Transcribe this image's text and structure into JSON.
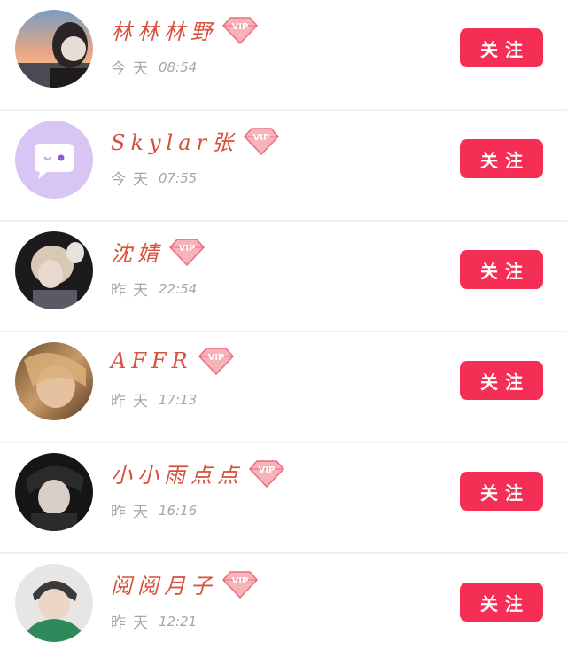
{
  "follow_label": "关注",
  "colors": {
    "accent": "#f42e54",
    "name": "#d8503e",
    "time": "#a6a6a6",
    "divider": "#f1f1f1"
  },
  "users": [
    {
      "name": "林林林野",
      "day": "今天",
      "time": "08:54",
      "vip": "VIP",
      "avatar": "sunset-photo"
    },
    {
      "name": "Skylar张",
      "day": "今天",
      "time": "07:55",
      "vip": "VIP",
      "avatar": "default-chat-bubble"
    },
    {
      "name": "沈婧",
      "day": "昨天",
      "time": "22:54",
      "vip": "VIP",
      "avatar": "person-photo"
    },
    {
      "name": "AFFR",
      "day": "昨天",
      "time": "17:13",
      "vip": "VIP",
      "avatar": "person-photo"
    },
    {
      "name": "小小雨点点",
      "day": "昨天",
      "time": "16:16",
      "vip": "VIP",
      "avatar": "person-photo"
    },
    {
      "name": "阅阅月子",
      "day": "昨天",
      "time": "12:21",
      "vip": "VIP",
      "avatar": "person-photo"
    }
  ]
}
